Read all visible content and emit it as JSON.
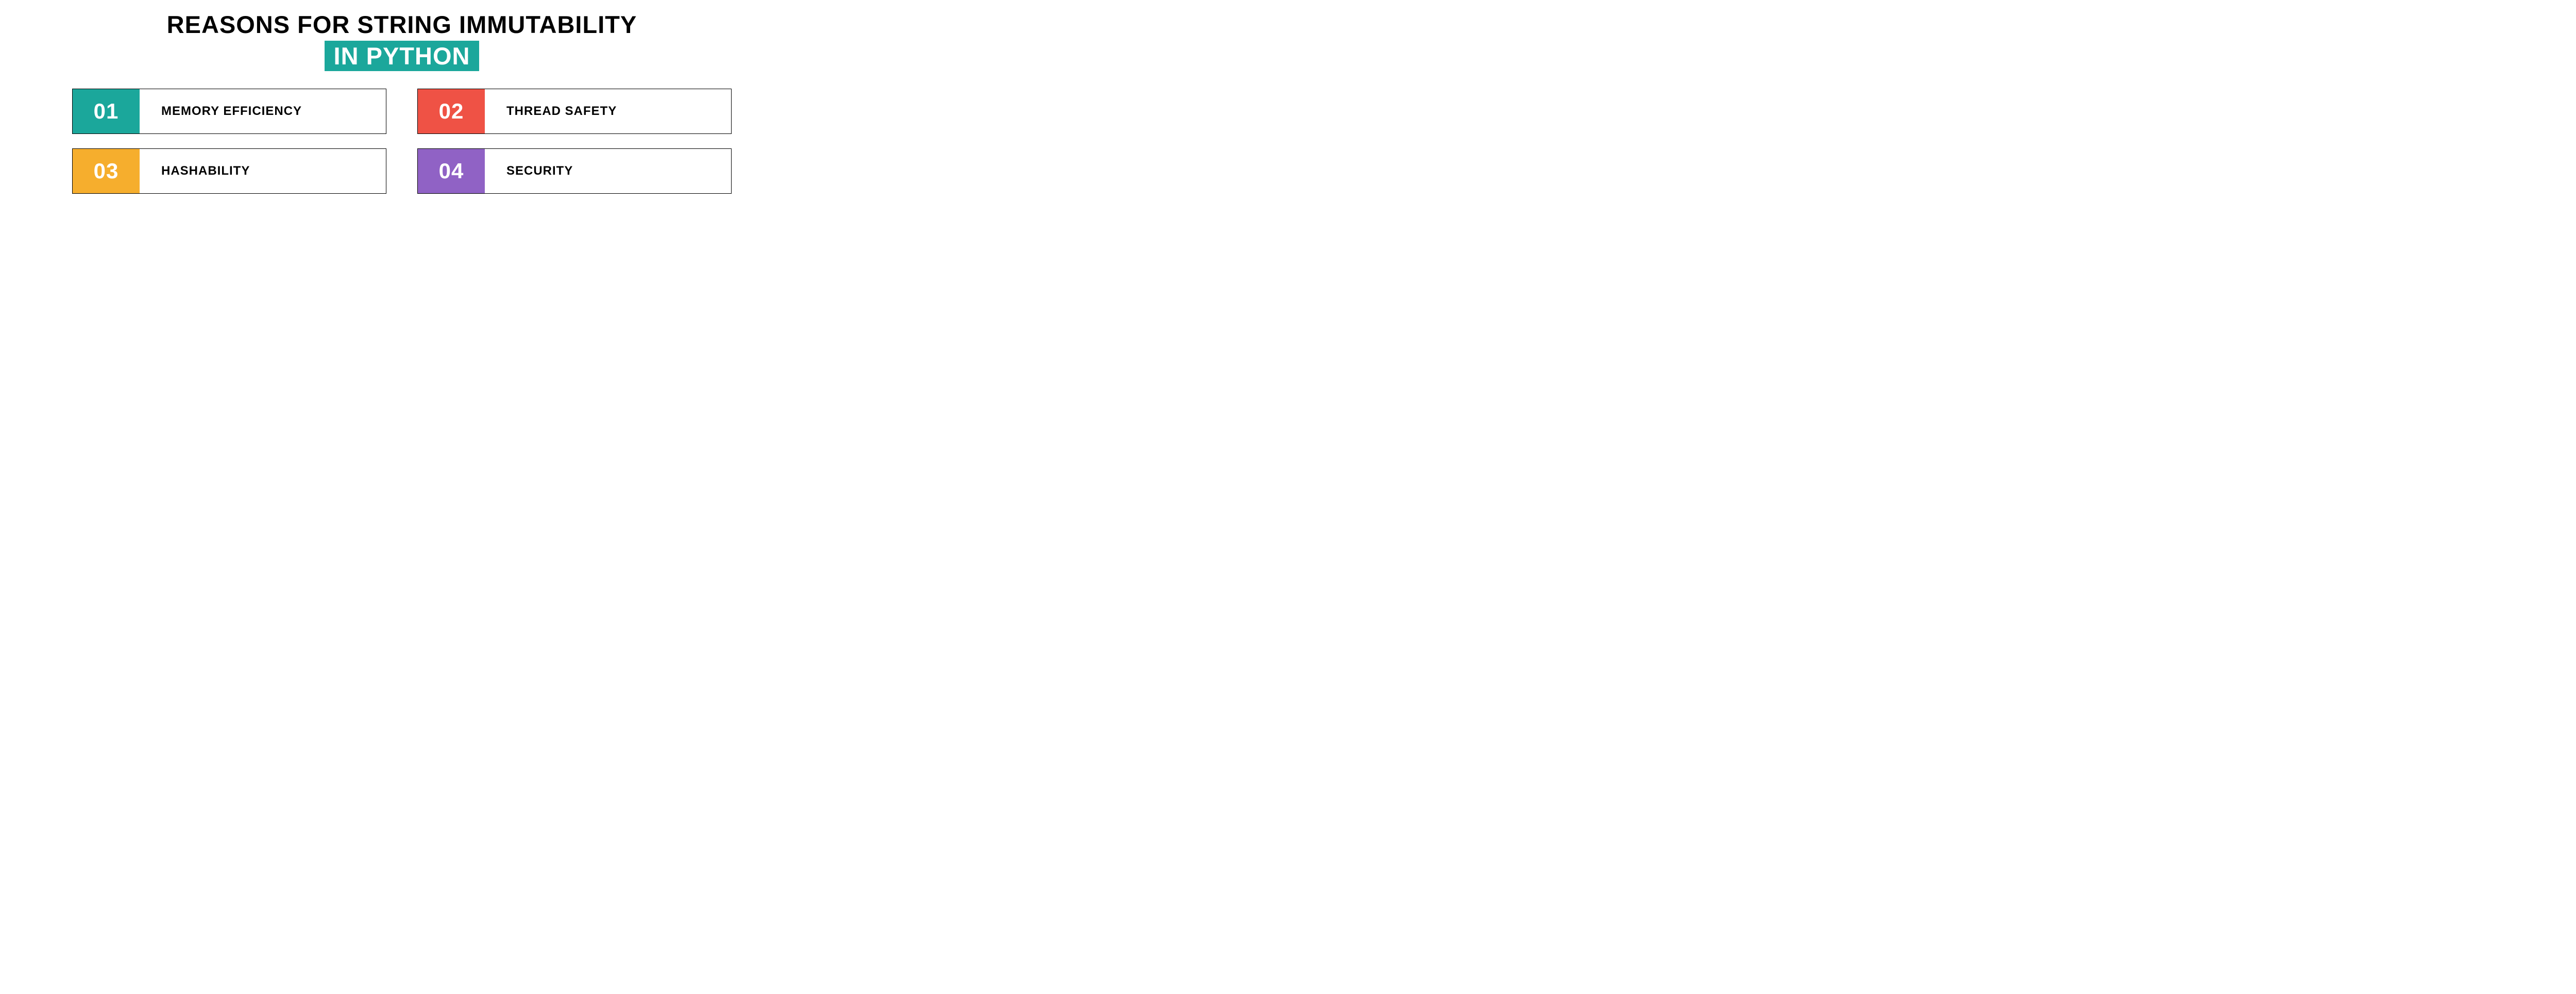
{
  "title": {
    "line1": "REASONS FOR STRING IMMUTABILITY",
    "line2": "IN PYTHON",
    "highlight_bg": "#1ba79b"
  },
  "items": [
    {
      "num": "01",
      "label": "MEMORY EFFICIENCY",
      "color": "#1ba79b"
    },
    {
      "num": "02",
      "label": "THREAD SAFETY",
      "color": "#ef5245"
    },
    {
      "num": "03",
      "label": "HASHABILITY",
      "color": "#f6ae2d"
    },
    {
      "num": "04",
      "label": "SECURITY",
      "color": "#9062c5"
    }
  ]
}
